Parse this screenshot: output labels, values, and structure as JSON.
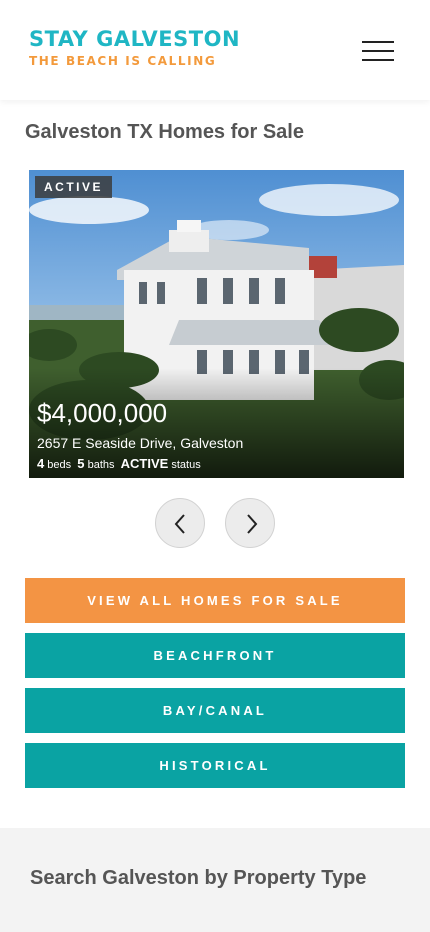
{
  "header": {
    "logo_title": "STAY GALVESTON",
    "logo_tagline": "THE BEACH IS CALLING",
    "menu_icon": "hamburger-menu-icon"
  },
  "main": {
    "section_title": "Galveston TX Homes for Sale",
    "listing": {
      "status_badge": "ACTIVE",
      "price": "$4,000,000",
      "address": "2657 E Seaside Drive, Galveston",
      "beds": "4",
      "beds_label": "beds",
      "baths": "5",
      "baths_label": "baths",
      "status": "ACTIVE",
      "status_label": "status"
    },
    "carousel": {
      "prev_icon": "chevron-left-icon",
      "next_icon": "chevron-right-icon"
    },
    "buttons": {
      "view_all": "VIEW ALL HOMES FOR SALE",
      "beachfront": "BEACHFRONT",
      "bay_canal": "BAY/CANAL",
      "historical": "HISTORICAL"
    }
  },
  "search_section": {
    "title": "Search Galveston by Property Type"
  },
  "colors": {
    "brand_teal": "#1fb6c4",
    "brand_orange": "#f39a3c",
    "cta_orange": "#f39444",
    "cta_teal": "#0aa3a3"
  }
}
